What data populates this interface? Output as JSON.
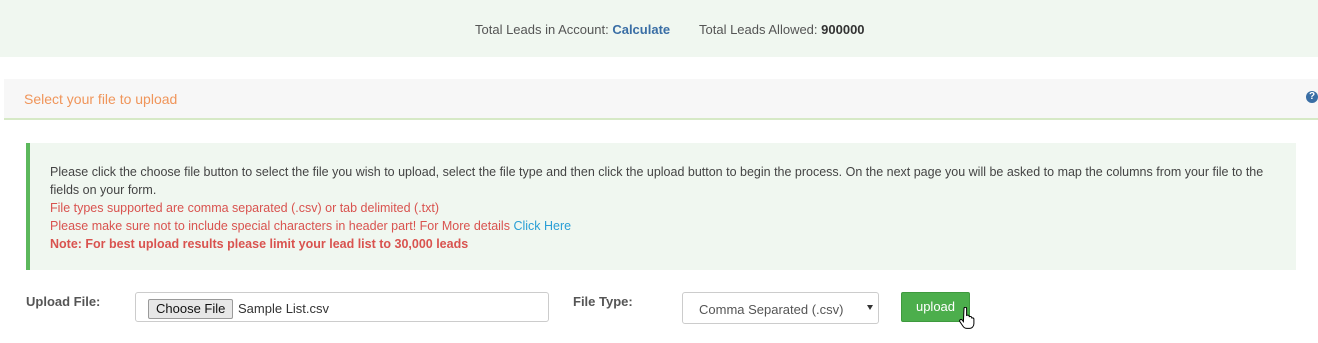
{
  "leads_bar": {
    "total_leads_label": "Total Leads in Account:",
    "calculate_link": "Calculate",
    "total_allowed_label": "Total Leads Allowed:",
    "total_allowed_value": "900000"
  },
  "panel": {
    "title": "Select your file to upload",
    "help_icon": "question-circle-icon"
  },
  "instructions": {
    "line1": "Please click the choose file button to select the file you wish to upload, select the file type and then click the upload button to begin the process. On the next page you will be asked to map the columns from your file to the fields on your form.",
    "line2": "File types supported are comma separated (.csv) or tab delimited (.txt)",
    "line3": "Please make sure not to include special characters in header part! For More details",
    "line3_link": "Click Here",
    "line4": "Note: For best upload results please limit your lead list to 30,000 leads"
  },
  "form": {
    "upload_file_label": "Upload File:",
    "choose_file_button": "Choose File",
    "file_name": "Sample List.csv",
    "file_type_label": "File Type:",
    "file_type_selected": "Comma Separated (.csv)",
    "upload_button": "upload"
  },
  "colors": {
    "accent_green": "#4cae4c",
    "title_orange": "#f0955a",
    "link_blue": "#2a9fd6",
    "warning_red": "#d9534f"
  }
}
